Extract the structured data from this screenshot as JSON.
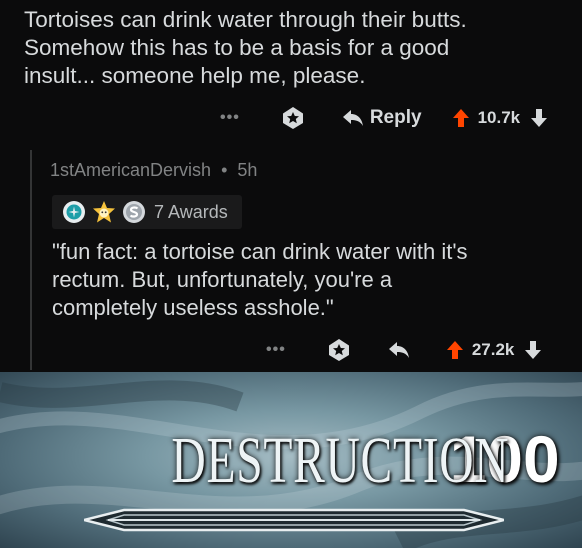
{
  "post": {
    "lines": [
      "Tortoises can drink water through their butts.",
      "Somehow this has to be a basis for a good",
      "insult... someone help me, please."
    ],
    "actions": {
      "more": "•••",
      "reply_label": "Reply",
      "score": "10.7k"
    }
  },
  "comment": {
    "author": "1stAmericanDervish",
    "separator": "•",
    "age": "5h",
    "awards_label": "7 Awards",
    "lines": [
      "\"fun fact: a tortoise can drink water with it's",
      "rectum.  But, unfortunately, you're a",
      "completely useless asshole.\""
    ],
    "actions": {
      "more": "•••",
      "score": "27.2k"
    }
  },
  "banner": {
    "word": "DESTRUCTION",
    "level": "100"
  },
  "colors": {
    "upvote": "#ff4500",
    "text": "#d7dadc",
    "muted": "#818384",
    "background": "#0b0b0c"
  }
}
